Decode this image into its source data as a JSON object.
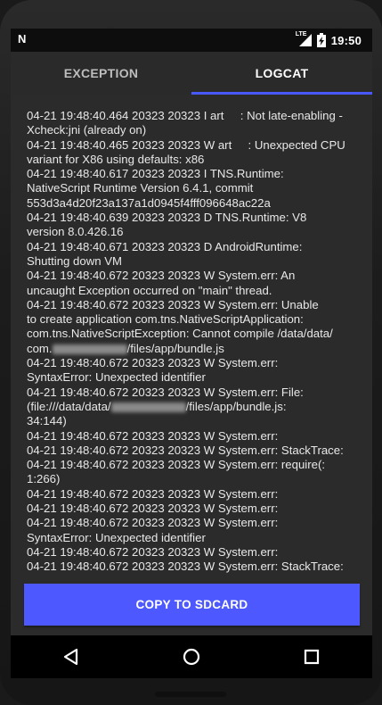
{
  "status_bar": {
    "network_label": "LTE",
    "time": "19:50"
  },
  "tabs": [
    {
      "label": "EXCEPTION",
      "active": false
    },
    {
      "label": "LOGCAT",
      "active": true
    }
  ],
  "log": {
    "lines": [
      "04-21 19:48:40.464 20323 20323 I art     : Not late-enabling -",
      "Xcheck:jni (already on)",
      "04-21 19:48:40.465 20323 20323 W art     : Unexpected CPU",
      "variant for X86 using defaults: x86",
      "04-21 19:48:40.617 20323 20323 I TNS.Runtime:",
      "NativeScript Runtime Version 6.4.1, commit",
      "553d3a4d20f23a137a1d0945f4fff096648ac22a",
      "04-21 19:48:40.639 20323 20323 D TNS.Runtime: V8",
      "version 8.0.426.16",
      "04-21 19:48:40.671 20323 20323 D AndroidRuntime:",
      "Shutting down VM",
      "04-21 19:48:40.672 20323 20323 W System.err: An",
      "uncaught Exception occurred on \"main\" thread.",
      "04-21 19:48:40.672 20323 20323 W System.err: Unable",
      "to create application com.tns.NativeScriptApplication:",
      "com.tns.NativeScriptException: Cannot compile /data/data/",
      "com.░░░░░░░░░░░░/files/app/bundle.js",
      "04-21 19:48:40.672 20323 20323 W System.err:",
      "SyntaxError: Unexpected identifier",
      "04-21 19:48:40.672 20323 20323 W System.err: File:",
      "(file:///data/data/░░░░░░░░░░░░/files/app/bundle.js:",
      "34:144)",
      "04-21 19:48:40.672 20323 20323 W System.err:",
      "04-21 19:48:40.672 20323 20323 W System.err: StackTrace:",
      "04-21 19:48:40.672 20323 20323 W System.err: require(:",
      "1:266)",
      "04-21 19:48:40.672 20323 20323 W System.err:",
      "04-21 19:48:40.672 20323 20323 W System.err:",
      "04-21 19:48:40.672 20323 20323 W System.err:",
      "SyntaxError: Unexpected identifier",
      "04-21 19:48:40.672 20323 20323 W System.err:",
      "04-21 19:48:40.672 20323 20323 W System.err: StackTrace:"
    ]
  },
  "actions": {
    "copy_label": "COPY TO SDCARD"
  },
  "colors": {
    "accent": "#4d58ff",
    "tab_indicator": "#4859ff",
    "background": "#2b2b2b"
  },
  "icons": {
    "status_left": "notification-n-icon",
    "signal": "signal-icon",
    "battery": "battery-charging-icon",
    "nav_back": "back-triangle-icon",
    "nav_home": "home-circle-icon",
    "nav_recents": "recents-square-icon"
  }
}
